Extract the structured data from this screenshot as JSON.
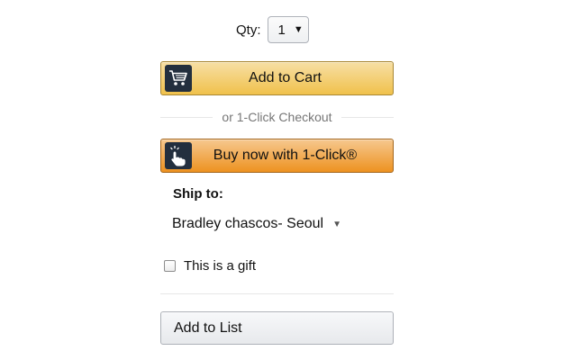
{
  "quantity": {
    "label": "Qty:",
    "selected_value": "1",
    "caret": "▼"
  },
  "add_to_cart": {
    "label": "Add to Cart",
    "icon": "cart-icon",
    "color": "#f0c14b"
  },
  "one_click_divider": {
    "text": "or 1-Click Checkout"
  },
  "buy_now": {
    "label": "Buy now with 1-Click®",
    "icon": "hand-pointer-icon",
    "color": "#ed9220"
  },
  "ship_to": {
    "heading": "Ship to:",
    "selected_address": "Bradley chascos- Seoul",
    "caret": "▼"
  },
  "gift": {
    "label": "This is a gift",
    "checked": false
  },
  "add_to_list": {
    "label": "Add to List"
  },
  "colors": {
    "icon_box": "#232f3e",
    "divider": "#e7e7e7"
  }
}
